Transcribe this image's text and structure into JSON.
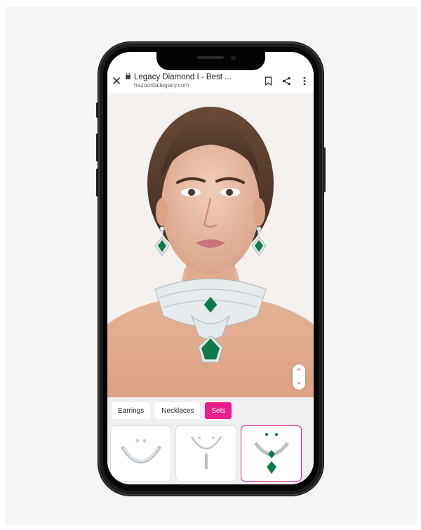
{
  "browser": {
    "close_icon": "close-icon",
    "page_title": "Legacy Diamond I - Best ...",
    "url": "hazoorilallegacy.com",
    "actions": [
      "bookmark-icon",
      "share-icon",
      "more-vertical-icon"
    ]
  },
  "preview": {
    "description_icon": "model-with-jewellery",
    "scroll_controls": [
      "chevron-up-icon",
      "chevron-down-icon"
    ]
  },
  "categories": {
    "tabs": [
      {
        "label": "Earrings",
        "active": false
      },
      {
        "label": "Necklaces",
        "active": false
      },
      {
        "label": "Sets",
        "active": true
      }
    ]
  },
  "products": [
    {
      "name": "diamond-necklace-set",
      "selected": false
    },
    {
      "name": "diamond-drop-necklace",
      "selected": false
    },
    {
      "name": "emerald-diamond-set",
      "selected": true
    }
  ],
  "colors": {
    "accent": "#e91e8c",
    "emerald": "#0e7a4a"
  }
}
